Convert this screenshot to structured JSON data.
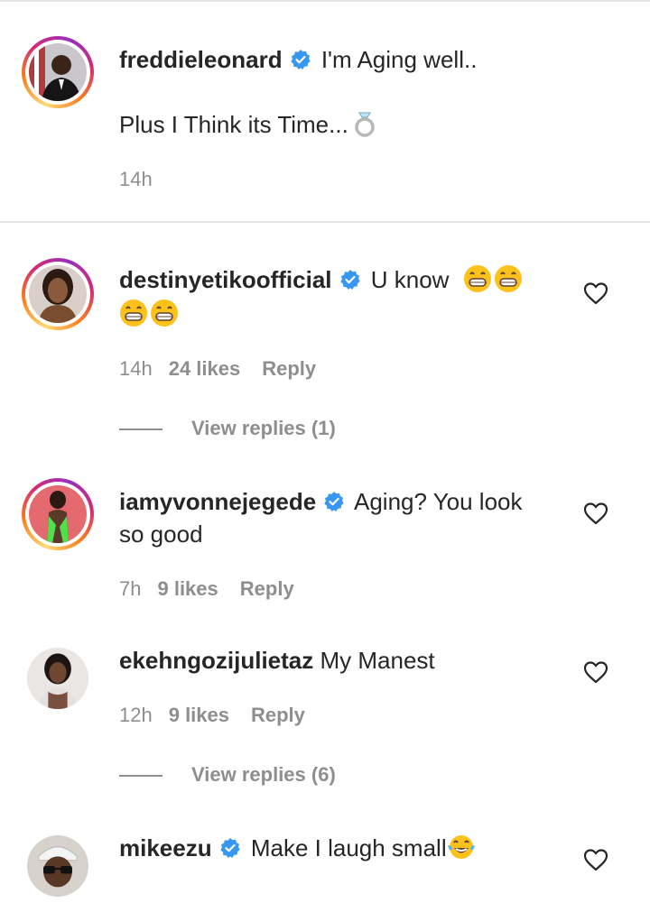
{
  "caption": {
    "username": "freddieleonard",
    "text_line1": "I'm Aging well..",
    "text_line2": "Plus I Think its Time...",
    "emoji": "ring-emoji",
    "time": "14h"
  },
  "comments": [
    {
      "username": "destinyetikoofficial",
      "verified": true,
      "text": "U know",
      "emojis": [
        "grin-emoji",
        "grin-emoji",
        "grin-emoji",
        "grin-emoji"
      ],
      "time": "14h",
      "likes": "24 likes",
      "reply": "Reply",
      "view_replies": "View replies (1)"
    },
    {
      "username": "iamyvonnejegede",
      "verified": true,
      "text_line1": "Aging? You look",
      "text_line2": "so good",
      "time": "7h",
      "likes": "9 likes",
      "reply": "Reply"
    },
    {
      "username": "ekehngozijulietaz",
      "verified": false,
      "text": "My Manest",
      "time": "12h",
      "likes": "9 likes",
      "reply": "Reply",
      "view_replies": "View replies (6)"
    },
    {
      "username": "mikeezu",
      "verified": true,
      "text": "Make I laugh small",
      "emojis": [
        "tears-of-joy-emoji"
      ]
    }
  ],
  "colors": {
    "text": "#262626",
    "secondary": "#8e8e8e",
    "verified_blue": "#3897f0",
    "divider": "#e6e6e6"
  }
}
